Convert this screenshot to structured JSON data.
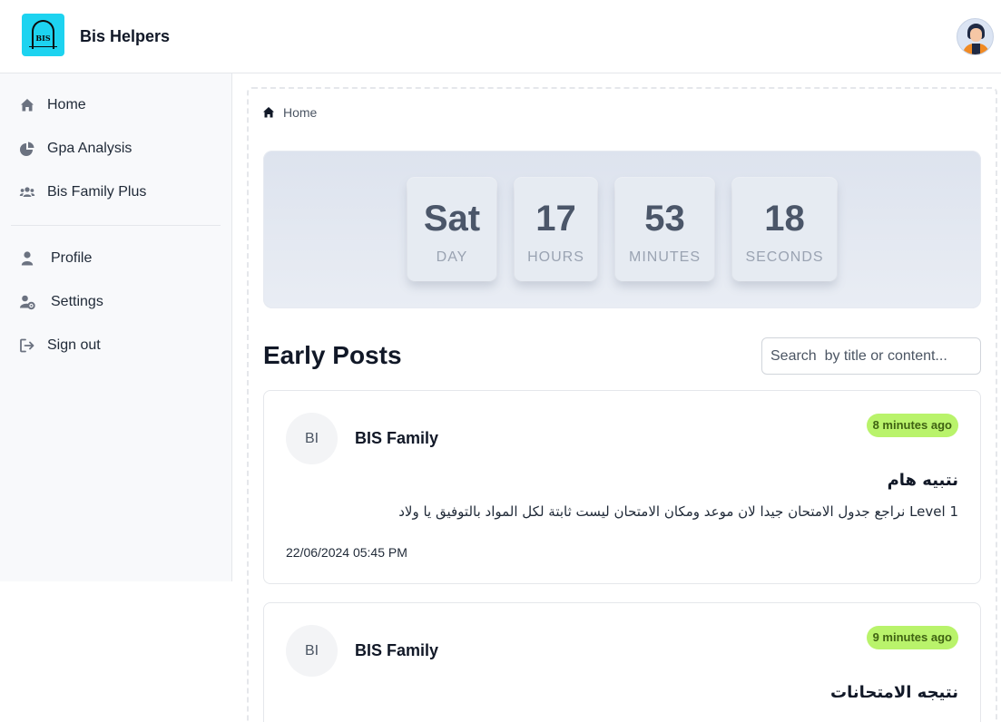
{
  "app": {
    "title": "Bis Helpers",
    "logo_text": "BIS"
  },
  "colors": {
    "logo_bg": "#1dd3f0",
    "badge_bg": "#b9f36b",
    "badge_text": "#3f6212",
    "countdown_bg": "#dde3ee"
  },
  "sidebar": {
    "primary": [
      {
        "label": "Home",
        "icon": "home-icon"
      },
      {
        "label": "Gpa Analysis",
        "icon": "pie-chart-icon"
      },
      {
        "label": "Bis Family Plus",
        "icon": "users-icon"
      }
    ],
    "secondary": [
      {
        "label": "Profile",
        "icon": "user-icon"
      },
      {
        "label": "Settings",
        "icon": "user-gear-icon"
      },
      {
        "label": "Sign out",
        "icon": "sign-out-icon"
      }
    ]
  },
  "breadcrumb": {
    "label": "Home",
    "icon": "home-icon"
  },
  "countdown": [
    {
      "value": "Sat",
      "unit": "DAY"
    },
    {
      "value": "17",
      "unit": "HOURS"
    },
    {
      "value": "53",
      "unit": "MINUTES"
    },
    {
      "value": "18",
      "unit": "SECONDS"
    }
  ],
  "posts_section": {
    "title": "Early Posts",
    "search_placeholder": "Search  by title or content..."
  },
  "posts": [
    {
      "avatar_initials": "BI",
      "author": "BIS Family",
      "time_ago": "8 minutes ago",
      "title": "نتبيه هام",
      "body": "Level 1 نراجع جدول الامتحان جيدا لان موعد ومكان الامتحان ليست ثابتة لكل المواد بالتوفيق يا ولاد",
      "date": "22/06/2024 05:45 PM"
    },
    {
      "avatar_initials": "BI",
      "author": "BIS Family",
      "time_ago": "9 minutes ago",
      "title": "نتيجه الامتحانات"
    }
  ]
}
